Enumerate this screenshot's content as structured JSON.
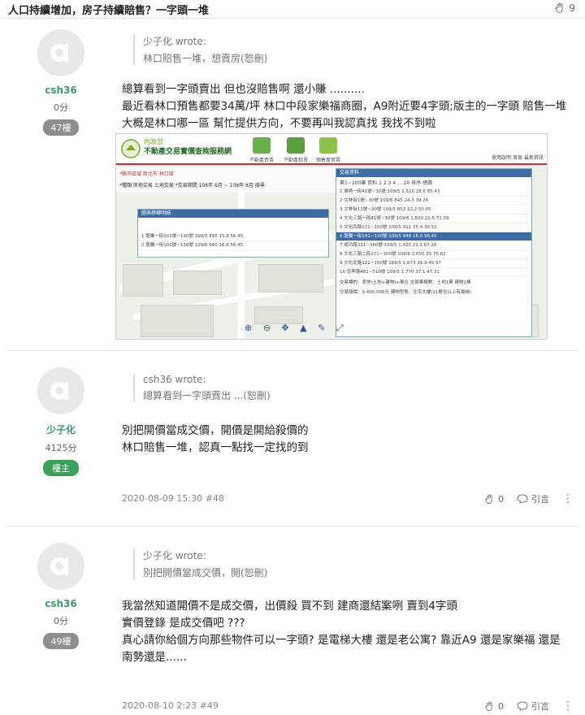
{
  "thread": {
    "title": "人口持續增加，房子持續賠售？一字頭一堆",
    "likes": "9"
  },
  "posts": [
    {
      "author": {
        "name": "csh36",
        "score": "0分",
        "floor": "47樓"
      },
      "quote": {
        "author": "少子化 wrote:",
        "text": "林口賠售一堆，想賣房(恕刪)"
      },
      "lines": [
        "總算看到一字頭賣出 但也沒賠售啊 還小賺 ..........",
        "最近看林口預售都要34萬/坪 林口中段家樂福商圈，A9附近要4字頭;版主的一字頭 賠售一堆",
        "大概是林口哪一區 幫忙提供方向，不要再叫我認真找 我找不到啦"
      ],
      "image": {
        "site_org": "內政部",
        "site_name": "不動產交易實價查詢服務網",
        "nav": [
          "不動產買賣",
          "不動產租賃",
          "預售屋買賣"
        ],
        "header_right": "使用說明  首頁  最新資訊",
        "filter_line1": "*縣市區域 新北市  林口區",
        "filter_line2": "*種類  房地交易  土地交易  *交易期間 108年 6月 ~ 108年 8月  搜尋",
        "panel_title": "交易資料",
        "panel_sub": "第1~200筆  資料 1 2 3 4 ... 20  排序 總價",
        "rows": [
          "1  東勢一街41號~30號      109/5  1,510  28.6  65.43",
          "2  文林街1號~30號          109/6   845  24.3  39.26",
          "3  文林街11號~30號        109/5   852  22.2  50.05",
          "4  文化三路一段41號~30號  109/6  1,600  22.5  71.09",
          "5  文化四路121~150號       109/5   911  35.4  30.52",
          "6  龍騰一街101~130號       109/5   949  16.6  56.45",
          "7  成功路331~360號         109/5  1,420  21.1  67.20",
          "8  文化三路二段271~300號   109/6  2,650   35  75.82",
          "9  文化北路121~150號       109/5  1,673  35.3  49.97",
          "10 忠孝路481~510號         109/5  1,770  37.1  47.31"
        ],
        "detail_line1": "交易標的：房地(土地+建物)+車位  交易筆棟數：土地1筆 建物1棟",
        "detail_line2": "交易總價：9,400,000元  建物型態：住宅大樓(11層含以上有電梯)",
        "small_panel_title": "圖表移轉明細",
        "small_rows": [
          "1  龍騰一街101號~130號  109/5  895  15.8  56.45",
          "2  龍騰一街101號~130號  109/6  940  16.6  56.45"
        ],
        "tools": "⊕ ⊖ ✥ ▲ ✎ ⤢"
      },
      "image_rows_selected_index": 5
    },
    {
      "author": {
        "name": "少子化",
        "score": "4125分",
        "floor": "樓主"
      },
      "quote": {
        "author": "csh36 wrote:",
        "text": "總算看到一字頭賣出 ...(恕刪)"
      },
      "lines": [
        "別把開價當成交價，開價是開給殺價的",
        "林口賠售一堆，認真一點找一定找的到"
      ],
      "meta": "2020-08-09 15:30 #48",
      "like_count": "0",
      "quote_label": "引言"
    },
    {
      "author": {
        "name": "csh36",
        "score": "0分",
        "floor": "49樓"
      },
      "quote": {
        "author": "少子化 wrote:",
        "text": "別把開價當成交價，開(恕刪)"
      },
      "lines": [
        "我當然知道開價不是成交價，出價殺 買不到 建商還結案咧 賣到4字頭",
        "實價登錄 是成交價吧 ???",
        "真心請你給個方向那些物件可以一字頭? 是電梯大樓 還是老公寓? 靠近A9 還是家樂福 還是",
        "南勢還是......"
      ],
      "meta": "2020-08-10 2:23 #49",
      "like_count": "0",
      "quote_label": "引言"
    }
  ],
  "colors": {
    "username": "#3a9b6e",
    "op_badge": "#3aa05a",
    "floor_badge": "#8e8e8e"
  }
}
